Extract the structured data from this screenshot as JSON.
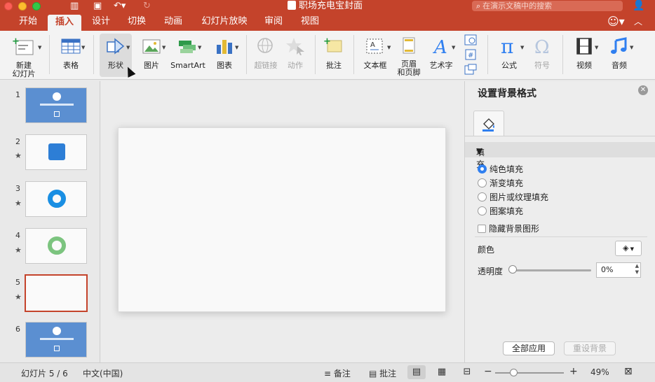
{
  "window": {
    "title": "职场充电宝封面",
    "search_placeholder": "在演示文稿中的搜索"
  },
  "tabs": [
    {
      "label": "开始"
    },
    {
      "label": "插入"
    },
    {
      "label": "设计"
    },
    {
      "label": "切换"
    },
    {
      "label": "动画"
    },
    {
      "label": "幻灯片放映"
    },
    {
      "label": "审阅"
    },
    {
      "label": "视图"
    }
  ],
  "active_tab": "插入",
  "ribbon": {
    "new_slide": "新建\n幻灯片",
    "table": "表格",
    "shapes": "形状",
    "picture": "图片",
    "smartart": "SmartArt",
    "chart": "图表",
    "hyperlink": "超链接",
    "action": "动作",
    "comment": "批注",
    "textbox": "文本框",
    "header_footer": "页眉\n和页脚",
    "wordart": "艺术字",
    "equation": "公式",
    "symbol": "符号",
    "video": "视频",
    "audio": "音频"
  },
  "slides": [
    {
      "number": "1",
      "starred": false
    },
    {
      "number": "2",
      "starred": true
    },
    {
      "number": "3",
      "starred": true
    },
    {
      "number": "4",
      "starred": true
    },
    {
      "number": "5",
      "starred": true
    },
    {
      "number": "6",
      "starred": false
    }
  ],
  "star_glyph": "★",
  "pane": {
    "title": "设置背景格式",
    "section": "填充",
    "options": [
      "纯色填充",
      "渐变填充",
      "图片或纹理填充",
      "图案填充"
    ],
    "selected_option": "纯色填充",
    "hide_bg_graphics": "隐藏背景图形",
    "color_label": "颜色",
    "transparency_label": "透明度",
    "transparency_value": "0%",
    "apply_all": "全部应用",
    "reset_bg": "重设背景"
  },
  "status": {
    "slide_counter": "幻灯片 5 / 6",
    "language": "中文(中国)",
    "notes": "备注",
    "comments": "批注",
    "zoom": "49%"
  },
  "colors": {
    "accent": "#c4432b",
    "slide_blue": "#5b8fd1",
    "radio_on": "#2f7ff0"
  }
}
